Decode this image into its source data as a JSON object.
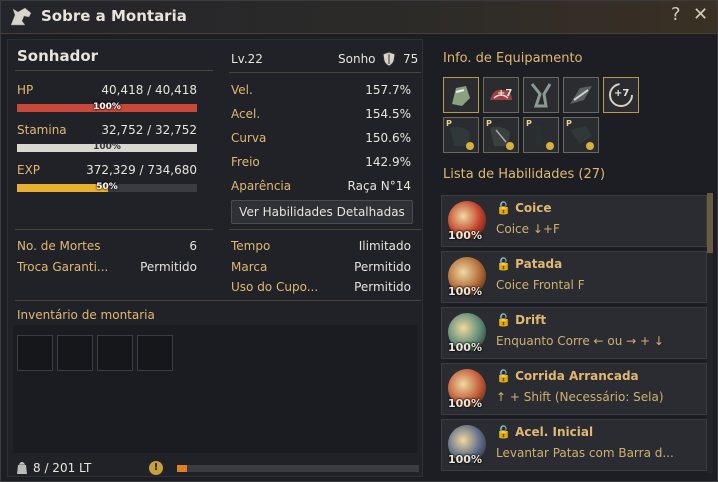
{
  "window": {
    "title": "Sobre a Montaria",
    "help": "?",
    "close": "✕"
  },
  "mount": {
    "name": "Sonhador",
    "level": "Lv.22",
    "dream_label": "Sonho",
    "dream_value": "75",
    "hp": {
      "label": "HP",
      "value": "40,418 / 40,418",
      "pct_text": "100%",
      "fill": 1.0,
      "color": "#c8483a"
    },
    "stamina": {
      "label": "Stamina",
      "value": "32,752 / 32,752",
      "pct_text": "100%",
      "fill": 1.0,
      "color": "#d8d8d0"
    },
    "exp": {
      "label": "EXP",
      "value": "372,329 / 734,680",
      "pct_text": "50%",
      "fill": 0.506,
      "color": "#e8b030"
    }
  },
  "stats": [
    {
      "label": "Vel.",
      "value": "157.7%"
    },
    {
      "label": "Acel.",
      "value": "154.5%"
    },
    {
      "label": "Curva",
      "value": "150.6%"
    },
    {
      "label": "Freio",
      "value": "142.9%"
    },
    {
      "label": "Aparência",
      "value": "Raça N°14"
    }
  ],
  "detail_button": "Ver Habilidades Detalhadas",
  "info_left": [
    {
      "label": "No. de Mortes",
      "value": "6"
    },
    {
      "label": "Troca Garanti...",
      "value": "Permitido"
    }
  ],
  "info_right": [
    {
      "label": "Tempo",
      "value": "Ilimitado"
    },
    {
      "label": "Marca",
      "value": "Permitido"
    },
    {
      "label": "Uso do Cupo...",
      "value": "Permitido"
    }
  ],
  "inventory": {
    "title": "Inventário de montaria",
    "weight": "8 / 201 LT",
    "weight_fill": 0.04
  },
  "equipment": {
    "title": "Info. de Equipamento",
    "row1": [
      {
        "icon": "armor-piece-icon",
        "badge": "",
        "p": ""
      },
      {
        "icon": "saddle-icon",
        "badge": "+7",
        "p": ""
      },
      {
        "icon": "stirrup-icon",
        "badge": "",
        "p": ""
      },
      {
        "icon": "horseshoe-icon",
        "badge": "",
        "p": ""
      },
      {
        "icon": "upgrade-icon",
        "badge": "+7",
        "p": ""
      }
    ],
    "row2": [
      {
        "icon": "barding-icon",
        "badge": "",
        "p": "P"
      },
      {
        "icon": "mane-icon",
        "badge": "",
        "p": "P"
      },
      {
        "icon": "cloak-icon",
        "badge": "",
        "p": "P"
      },
      {
        "icon": "hood-icon",
        "badge": "",
        "p": "P"
      }
    ]
  },
  "skills": {
    "title": "Lista de Habilidades (27)",
    "items": [
      {
        "name": "Coice",
        "command": "Coice ↓+F",
        "pct": "100%",
        "color": "#c0402a"
      },
      {
        "name": "Patada",
        "command": "Coice Frontal F",
        "pct": "100%",
        "color": "#b06838"
      },
      {
        "name": "Drift",
        "command": "Enquanto Corre ← ou → + ↓",
        "pct": "100%",
        "color": "#5a8a78"
      },
      {
        "name": "Corrida Arrancada",
        "command": "↑ + Shift (Necessário: Sela)",
        "pct": "100%",
        "color": "#c05838"
      },
      {
        "name": "Acel. Inicial",
        "command": "Levantar Patas com Barra d...",
        "pct": "100%",
        "color": "#5a6a88"
      }
    ]
  }
}
